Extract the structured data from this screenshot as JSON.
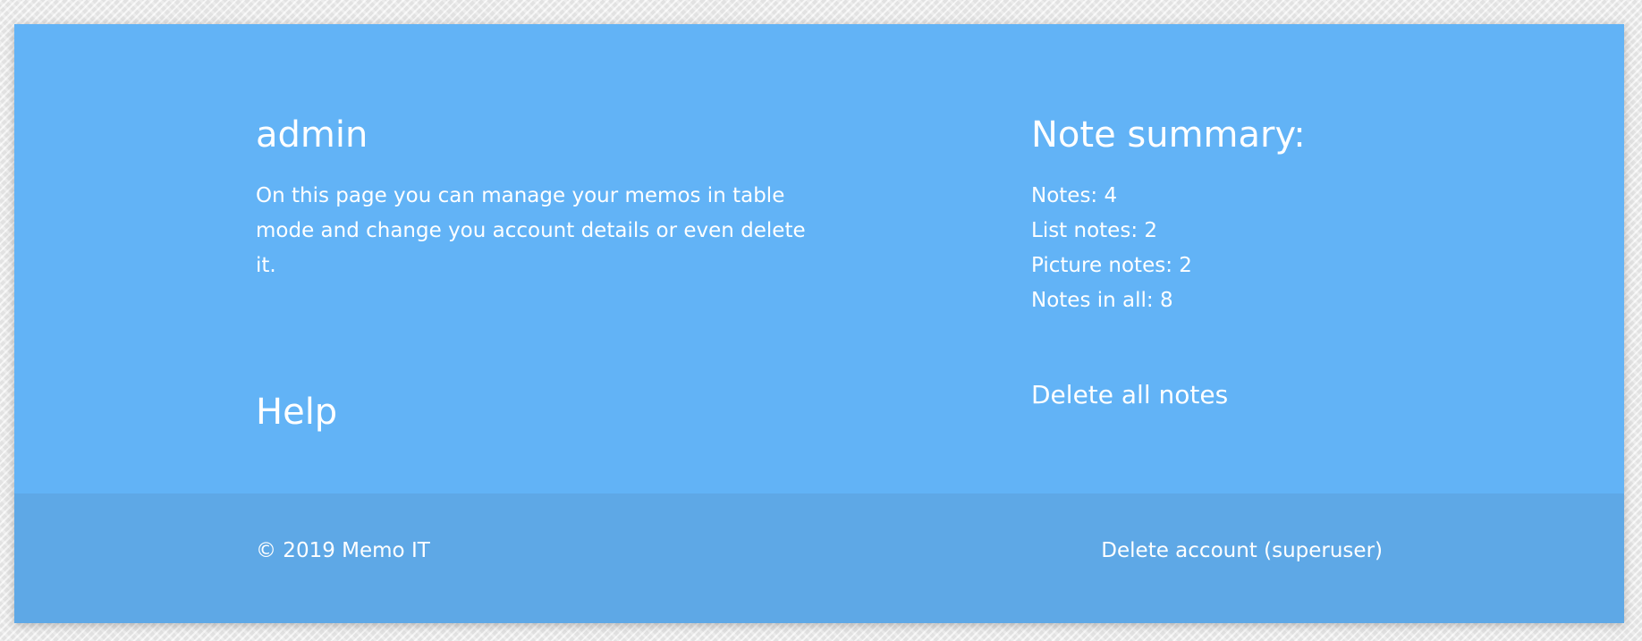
{
  "user": {
    "name": "admin",
    "description": "On this page you can manage your memos in table mode and change you account details or even delete it."
  },
  "help": {
    "label": "Help"
  },
  "summary": {
    "title": "Note summary:",
    "items": [
      {
        "label": "Notes:",
        "value": "4"
      },
      {
        "label": "List notes:",
        "value": "2"
      },
      {
        "label": "Picture notes:",
        "value": "2"
      },
      {
        "label": "Notes in all:",
        "value": "8"
      }
    ],
    "delete_all_label": "Delete all notes"
  },
  "footer": {
    "copyright": "© 2019 Memo IT",
    "delete_account_label": "Delete account (superuser)"
  },
  "colors": {
    "main_panel": "#62b3f6",
    "footer": "#5ea8e6",
    "text": "#ffffff"
  }
}
